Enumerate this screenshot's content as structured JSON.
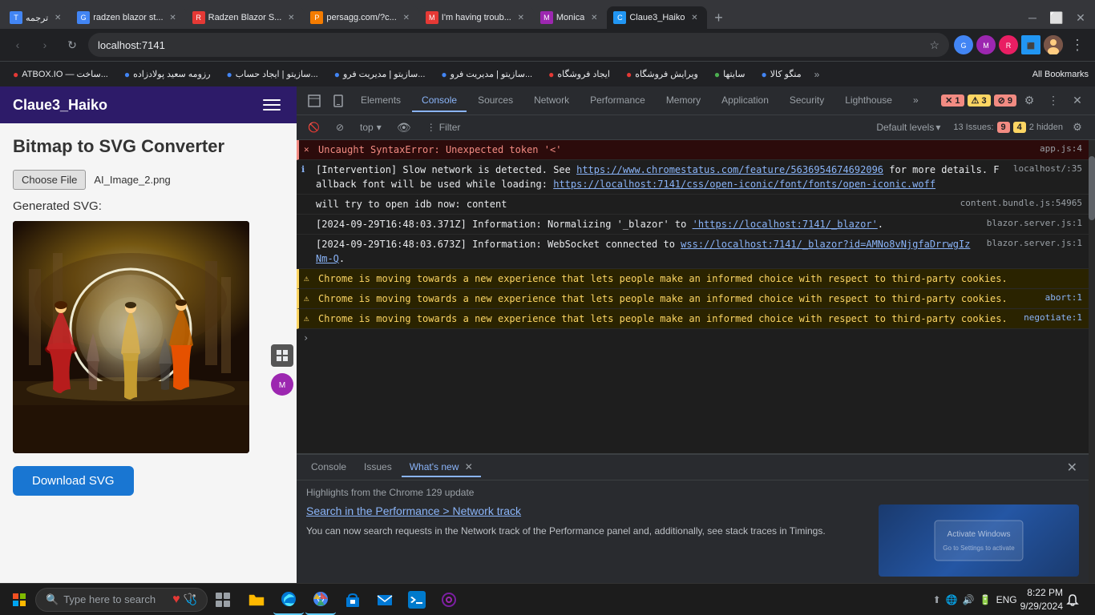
{
  "browser": {
    "tabs": [
      {
        "id": "t1",
        "favicon_color": "#4285f4",
        "label": "ترجمه",
        "active": false
      },
      {
        "id": "t2",
        "favicon_color": "#4285f4",
        "label": "radzen blazor st...",
        "active": false
      },
      {
        "id": "t3",
        "favicon_color": "#e53935",
        "label": "Radzen Blazor S...",
        "active": false
      },
      {
        "id": "t4",
        "favicon_color": "#f57c00",
        "label": "persagg.com/?c...",
        "active": false
      },
      {
        "id": "t5",
        "favicon_color": "#e53935",
        "label": "I'm having troub...",
        "active": false
      },
      {
        "id": "t6",
        "favicon_color": "#9c27b0",
        "label": "Monica",
        "active": false
      },
      {
        "id": "t7",
        "favicon_color": "#2196f3",
        "label": "Claue3_Haiko",
        "active": true
      }
    ],
    "url": "localhost:7141",
    "new_tab_label": "+"
  },
  "bookmarks": [
    {
      "label": "ATBOX.IO — ساخت...",
      "color": "#e53935"
    },
    {
      "label": "رزومه سعید پولادزاده",
      "color": "#4285f4"
    },
    {
      "label": "سازیتو | ایجاد حساب...",
      "color": "#4285f4"
    },
    {
      "label": "سازیتو | مدیریت فرو...",
      "color": "#4285f4"
    },
    {
      "label": "سازیتو | مدیریت فرو...",
      "color": "#4285f4"
    },
    {
      "label": "ایجاد فروشگاه",
      "color": "#e53935"
    },
    {
      "label": "ویرایش فروشگاه",
      "color": "#e53935"
    },
    {
      "label": "سایتها",
      "color": "#4caf50"
    },
    {
      "label": "منگو کالا",
      "color": "#4285f4"
    }
  ],
  "app": {
    "title": "Claue3_Haiko",
    "nav_toggle": "☰",
    "heading": "Bitmap to SVG Converter",
    "choose_file_label": "Choose File",
    "file_name": "AI_Image_2.png",
    "generated_label": "Generated SVG:",
    "download_label": "Download SVG"
  },
  "devtools": {
    "tabs": [
      "Elements",
      "Console",
      "Sources",
      "Network",
      "Performance",
      "Memory",
      "Application",
      "Security",
      "Lighthouse"
    ],
    "active_tab": "Console",
    "errors": 1,
    "warnings": 3,
    "issues_9": 9,
    "issues_4": 4,
    "hidden": 2,
    "filter_placeholder": "Filter",
    "level_label": "Default levels",
    "top_label": "top",
    "console_lines": [
      {
        "type": "error",
        "text": "Uncaught SyntaxError: Unexpected token '<'",
        "location": "app.js:4"
      },
      {
        "type": "info",
        "text": "[Intervention] Slow network is detected. See https://www.chromestatus.com/feature/5636954674692096 for more details. Fallback font will be used while loading: https://localhost:7141/css/open-iconic/font/fonts/open-iconic.woff",
        "location": "localhost/:35"
      },
      {
        "type": "normal",
        "text": "will try to open idb now: content",
        "location": "content.bundle.js:54965"
      },
      {
        "type": "info",
        "text": "[2024-09-29T16:48:03.371Z] Information: Normalizing '_blazor' to 'https://localhost:7141/_blazor'.",
        "location": "blazor.server.js:1"
      },
      {
        "type": "info",
        "text": "[2024-09-29T16:48:03.673Z] Information: WebSocket connected to wss://localhost:7141/_blazor?id=AMNo8vNjgfaDrrwgIzNm-Q.",
        "location": "blazor.server.js:1"
      },
      {
        "type": "warning",
        "text": "Chrome is moving towards a new experience that lets people make an informed choice with respect to third-party cookies.",
        "location": ""
      },
      {
        "type": "warning",
        "text": "Chrome is moving towards a new experience that lets people make an informed choice with respect to third-party cookies.",
        "location": "abort:1"
      },
      {
        "type": "warning",
        "text": "Chrome is moving towards a new experience that lets people make an informed choice with respect to third-party cookies.",
        "location": "negotiate:1"
      }
    ],
    "bottom_tabs": [
      "Console",
      "Issues",
      "What's new"
    ],
    "active_bottom_tab": "What's new",
    "whats_new_title": "Highlights from the Chrome 129 update",
    "whats_new_link": "Search in the Performance > Network track",
    "whats_new_desc": "You can now search requests in the Network track of the Performance panel and, additionally, see stack traces in Timings."
  },
  "taskbar": {
    "search_placeholder": "Type here to search",
    "time": "8:22 PM",
    "date": "9/29/2024",
    "language": "ENG"
  }
}
